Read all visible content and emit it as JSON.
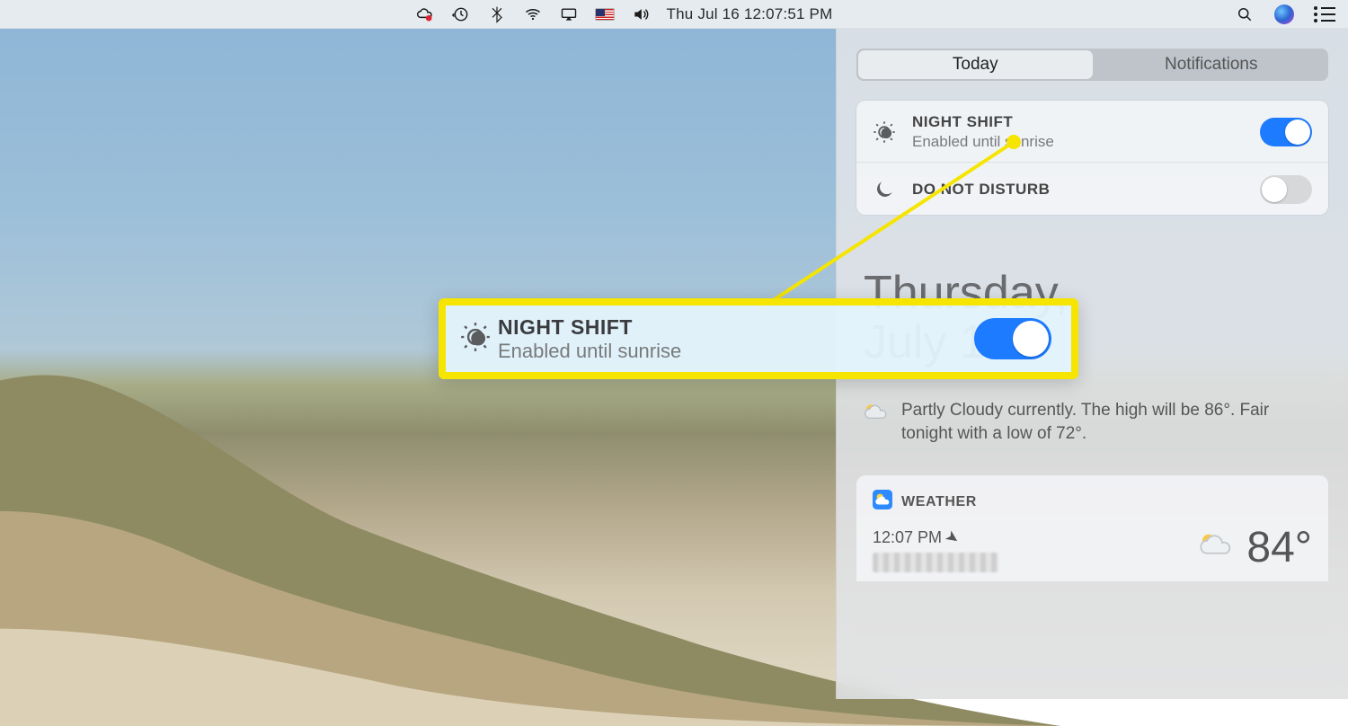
{
  "menubar": {
    "datetime": "Thu Jul 16  12:07:51 PM"
  },
  "nc": {
    "tabs": {
      "today": "Today",
      "notifications": "Notifications",
      "active": "today"
    },
    "night_shift": {
      "title": "NIGHT SHIFT",
      "sub": "Enabled until sunrise",
      "on": true
    },
    "dnd": {
      "title": "DO NOT DISTURB",
      "on": false
    },
    "date_line1": "Thursday,",
    "date_line2": "July 16",
    "weather_summary": "Partly Cloudy currently. The high will be 86°. Fair tonight with a low of 72°.",
    "widget": {
      "header": "WEATHER",
      "time": "12:07 PM",
      "temp": "84°"
    }
  },
  "callout": {
    "title": "NIGHT SHIFT",
    "sub": "Enabled until sunrise"
  }
}
